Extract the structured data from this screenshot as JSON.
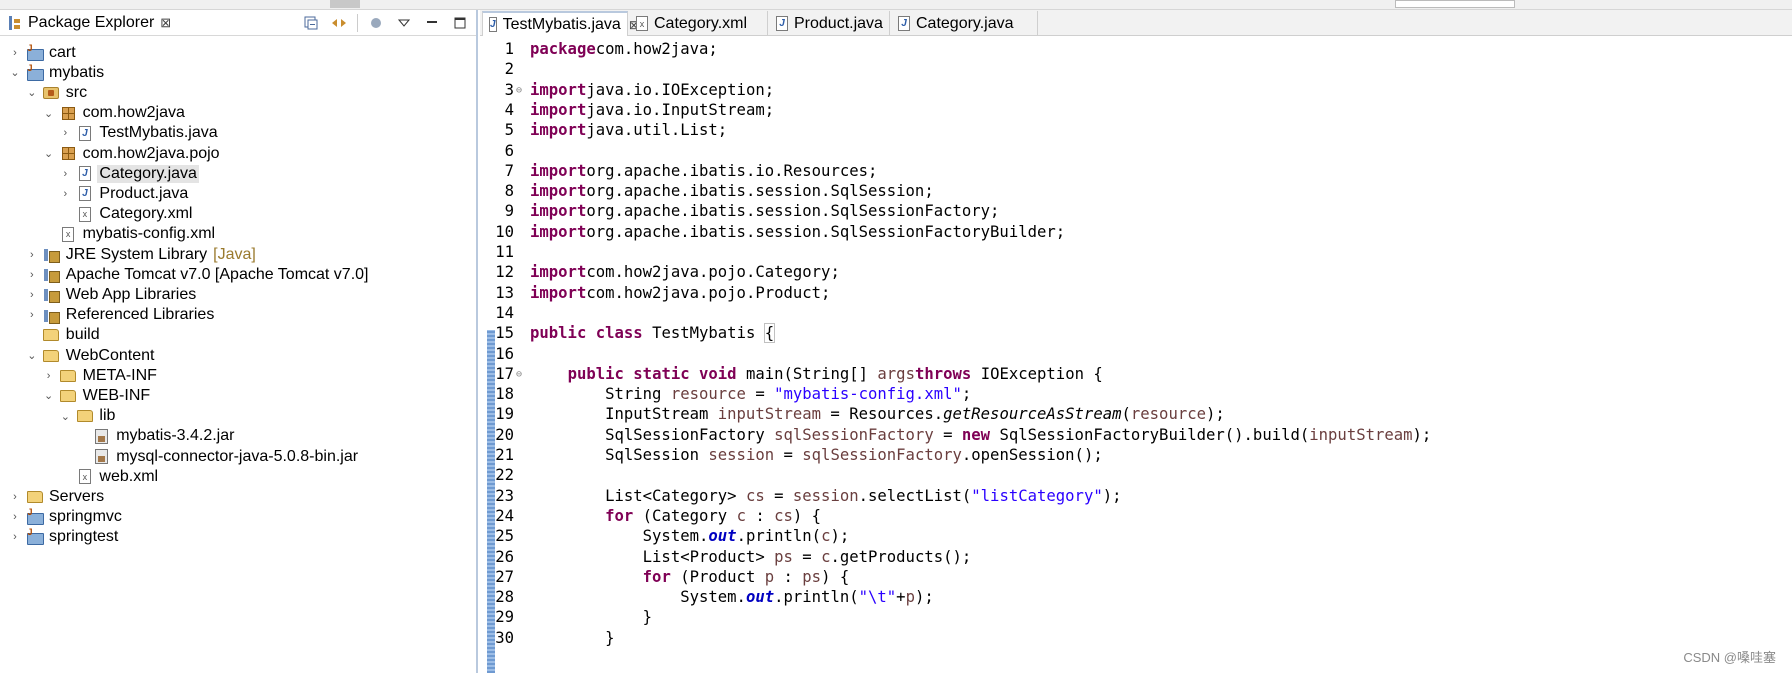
{
  "package_explorer": {
    "title": "Package Explorer",
    "close_glyph": "⊠",
    "tree": [
      {
        "label": "cart",
        "icon": "project-icon",
        "depth": 0,
        "chevron": "›"
      },
      {
        "label": "mybatis",
        "icon": "project-icon",
        "depth": 0,
        "chevron": "⌄"
      },
      {
        "label": "src",
        "icon": "source-folder-icon",
        "depth": 1,
        "chevron": "⌄"
      },
      {
        "label": "com.how2java",
        "icon": "package-icon",
        "depth": 2,
        "chevron": "⌄"
      },
      {
        "label": "TestMybatis.java",
        "icon": "java-file-icon",
        "depth": 3,
        "chevron": "›"
      },
      {
        "label": "com.how2java.pojo",
        "icon": "package-icon",
        "depth": 2,
        "chevron": "⌄"
      },
      {
        "label": "Category.java",
        "icon": "java-file-icon",
        "depth": 3,
        "chevron": "›",
        "selected": true
      },
      {
        "label": "Product.java",
        "icon": "java-file-icon",
        "depth": 3,
        "chevron": "›"
      },
      {
        "label": "Category.xml",
        "icon": "xml-file-icon",
        "depth": 3,
        "chevron": ""
      },
      {
        "label": "mybatis-config.xml",
        "icon": "xml-file-icon",
        "depth": 2,
        "chevron": ""
      },
      {
        "label": "JRE System Library",
        "decoration": "[Java]",
        "icon": "library-icon",
        "depth": 1,
        "chevron": "›"
      },
      {
        "label": "Apache Tomcat v7.0 [Apache Tomcat v7.0]",
        "icon": "library-icon",
        "depth": 1,
        "chevron": "›"
      },
      {
        "label": "Web App Libraries",
        "icon": "library-icon",
        "depth": 1,
        "chevron": "›"
      },
      {
        "label": "Referenced Libraries",
        "icon": "library-icon",
        "depth": 1,
        "chevron": "›"
      },
      {
        "label": "build",
        "icon": "folder-icon",
        "depth": 1,
        "chevron": ""
      },
      {
        "label": "WebContent",
        "icon": "folder-icon",
        "depth": 1,
        "chevron": "⌄"
      },
      {
        "label": "META-INF",
        "icon": "folder-icon",
        "depth": 2,
        "chevron": "›"
      },
      {
        "label": "WEB-INF",
        "icon": "folder-icon",
        "depth": 2,
        "chevron": "⌄"
      },
      {
        "label": "lib",
        "icon": "folder-icon",
        "depth": 3,
        "chevron": "⌄"
      },
      {
        "label": "mybatis-3.4.2.jar",
        "icon": "jar-icon",
        "depth": 4,
        "chevron": ""
      },
      {
        "label": "mysql-connector-java-5.0.8-bin.jar",
        "icon": "jar-icon",
        "depth": 4,
        "chevron": ""
      },
      {
        "label": "web.xml",
        "icon": "xml-file-icon",
        "depth": 3,
        "chevron": ""
      },
      {
        "label": "Servers",
        "icon": "folder-icon",
        "depth": 0,
        "chevron": "›"
      },
      {
        "label": "springmvc",
        "icon": "project-icon",
        "depth": 0,
        "chevron": "›"
      },
      {
        "label": "springtest",
        "icon": "project-icon",
        "depth": 0,
        "chevron": "›"
      }
    ]
  },
  "editor": {
    "tabs": [
      {
        "label": "TestMybatis.java",
        "icon": "java-file-icon",
        "active": true,
        "close_glyph": "⊠"
      },
      {
        "label": "Category.xml",
        "icon": "xml-file-icon",
        "active": false
      },
      {
        "label": "Product.java",
        "icon": "java-file-icon",
        "active": false
      },
      {
        "label": "Category.java",
        "icon": "java-file-icon",
        "active": false
      }
    ],
    "lines": [
      {
        "n": "1",
        "fold": "",
        "tokens": [
          [
            "kw",
            "package"
          ],
          [
            "",
            "com.how2java;"
          ]
        ]
      },
      {
        "n": "2",
        "fold": "",
        "tokens": []
      },
      {
        "n": "3",
        "fold": "⊖",
        "tokens": [
          [
            "kw",
            "import"
          ],
          [
            "",
            "java.io.IOException;"
          ]
        ]
      },
      {
        "n": "4",
        "fold": "",
        "tokens": [
          [
            "kw",
            "import"
          ],
          [
            "",
            "java.io.InputStream;"
          ]
        ]
      },
      {
        "n": "5",
        "fold": "",
        "tokens": [
          [
            "kw",
            "import"
          ],
          [
            "",
            "java.util.List;"
          ]
        ]
      },
      {
        "n": "6",
        "fold": "",
        "tokens": []
      },
      {
        "n": "7",
        "fold": "",
        "tokens": [
          [
            "kw",
            "import"
          ],
          [
            "",
            "org.apache.ibatis.io.Resources;"
          ]
        ]
      },
      {
        "n": "8",
        "fold": "",
        "tokens": [
          [
            "kw",
            "import"
          ],
          [
            "",
            "org.apache.ibatis.session.SqlSession;"
          ]
        ]
      },
      {
        "n": "9",
        "fold": "",
        "tokens": [
          [
            "kw",
            "import"
          ],
          [
            "",
            "org.apache.ibatis.session.SqlSessionFactory;"
          ]
        ]
      },
      {
        "n": "10",
        "fold": "",
        "tokens": [
          [
            "kw",
            "import"
          ],
          [
            "",
            "org.apache.ibatis.session.SqlSessionFactoryBuilder;"
          ]
        ]
      },
      {
        "n": "11",
        "fold": "",
        "tokens": []
      },
      {
        "n": "12",
        "fold": "",
        "tokens": [
          [
            "kw",
            "import"
          ],
          [
            "",
            "com.how2java.pojo.Category;"
          ]
        ]
      },
      {
        "n": "13",
        "fold": "",
        "tokens": [
          [
            "kw",
            "import"
          ],
          [
            "",
            "com.how2java.pojo.Product;"
          ]
        ]
      },
      {
        "n": "14",
        "fold": "",
        "tokens": []
      },
      {
        "n": "15",
        "fold": "",
        "tokens": [
          [
            "kw",
            "public"
          ],
          [
            "kw",
            " class"
          ],
          [
            "",
            " TestMybatis "
          ],
          [
            "box",
            "{"
          ]
        ]
      },
      {
        "n": "16",
        "fold": "",
        "tokens": []
      },
      {
        "n": "17",
        "fold": "⊖",
        "tokens": [
          [
            "",
            "    "
          ],
          [
            "kw",
            "public"
          ],
          [
            "kw",
            " static"
          ],
          [
            "kw",
            " void"
          ],
          [
            "",
            " main(String[] "
          ],
          [
            "var",
            "args"
          ],
          [
            ") "
          ],
          [
            "kw",
            "throws"
          ],
          [
            "",
            " IOException {"
          ]
        ]
      },
      {
        "n": "18",
        "fold": "",
        "tokens": [
          [
            "",
            "        String "
          ],
          [
            "var",
            "resource"
          ],
          [
            "",
            " = "
          ],
          [
            "str",
            "\"mybatis-config.xml\""
          ],
          [
            "",
            ";"
          ]
        ]
      },
      {
        "n": "19",
        "fold": "",
        "tokens": [
          [
            "",
            "        InputStream "
          ],
          [
            "var",
            "inputStream"
          ],
          [
            "",
            " = Resources."
          ],
          [
            "itl",
            "getResourceAsStream"
          ],
          [
            "",
            "("
          ],
          [
            "var",
            "resource"
          ],
          [
            "",
            ");"
          ]
        ]
      },
      {
        "n": "20",
        "fold": "",
        "tokens": [
          [
            "",
            "        SqlSessionFactory "
          ],
          [
            "var",
            "sqlSessionFactory"
          ],
          [
            "",
            " = "
          ],
          [
            "kw",
            "new"
          ],
          [
            "",
            " SqlSessionFactoryBuilder().build("
          ],
          [
            "var",
            "inputStream"
          ],
          [
            "",
            ");"
          ]
        ]
      },
      {
        "n": "21",
        "fold": "",
        "tokens": [
          [
            "",
            "        SqlSession "
          ],
          [
            "var",
            "session"
          ],
          [
            "",
            " = "
          ],
          [
            "var",
            "sqlSessionFactory"
          ],
          [
            "",
            ".openSession();"
          ]
        ]
      },
      {
        "n": "22",
        "fold": "",
        "tokens": []
      },
      {
        "n": "23",
        "fold": "",
        "tokens": [
          [
            "",
            "        List<Category> "
          ],
          [
            "var",
            "cs"
          ],
          [
            "",
            " = "
          ],
          [
            "var",
            "session"
          ],
          [
            "",
            ".selectList("
          ],
          [
            "str",
            "\"listCategory\""
          ],
          [
            "",
            ");"
          ]
        ]
      },
      {
        "n": "24",
        "fold": "",
        "tokens": [
          [
            "",
            "        "
          ],
          [
            "kw",
            "for"
          ],
          [
            "",
            " (Category "
          ],
          [
            "var",
            "c"
          ],
          [
            "",
            " : "
          ],
          [
            "var",
            "cs"
          ],
          [
            "",
            ") {"
          ]
        ]
      },
      {
        "n": "25",
        "fold": "",
        "tokens": [
          [
            "",
            "            System."
          ],
          [
            "fld",
            "out"
          ],
          [
            "",
            ".println("
          ],
          [
            "var",
            "c"
          ],
          [
            "",
            ");"
          ]
        ]
      },
      {
        "n": "26",
        "fold": "",
        "tokens": [
          [
            "",
            "            List<Product> "
          ],
          [
            "var",
            "ps"
          ],
          [
            "",
            " = "
          ],
          [
            "var",
            "c"
          ],
          [
            "",
            ".getProducts();"
          ]
        ]
      },
      {
        "n": "27",
        "fold": "",
        "tokens": [
          [
            "",
            "            "
          ],
          [
            "kw",
            "for"
          ],
          [
            "",
            " (Product "
          ],
          [
            "var",
            "p"
          ],
          [
            "",
            " : "
          ],
          [
            "var",
            "ps"
          ],
          [
            "",
            ") {"
          ]
        ]
      },
      {
        "n": "28",
        "fold": "",
        "tokens": [
          [
            "",
            "                System."
          ],
          [
            "fld",
            "out"
          ],
          [
            "",
            ".println("
          ],
          [
            "str",
            "\"\\t\""
          ],
          [
            "",
            "+"
          ],
          [
            "var",
            "p"
          ],
          [
            "",
            ");"
          ]
        ]
      },
      {
        "n": "29",
        "fold": "",
        "tokens": [
          [
            "",
            "            }"
          ]
        ]
      },
      {
        "n": "30",
        "fold": "",
        "tokens": [
          [
            "",
            "        }"
          ]
        ]
      }
    ]
  },
  "watermark": "CSDN @嗓哇塞",
  "colors": {
    "keyword": "#7f0055",
    "string": "#2a00ff",
    "local_variable": "#6a3e3e",
    "static_field": "#0000c0",
    "selection": "#e4e4e4"
  }
}
